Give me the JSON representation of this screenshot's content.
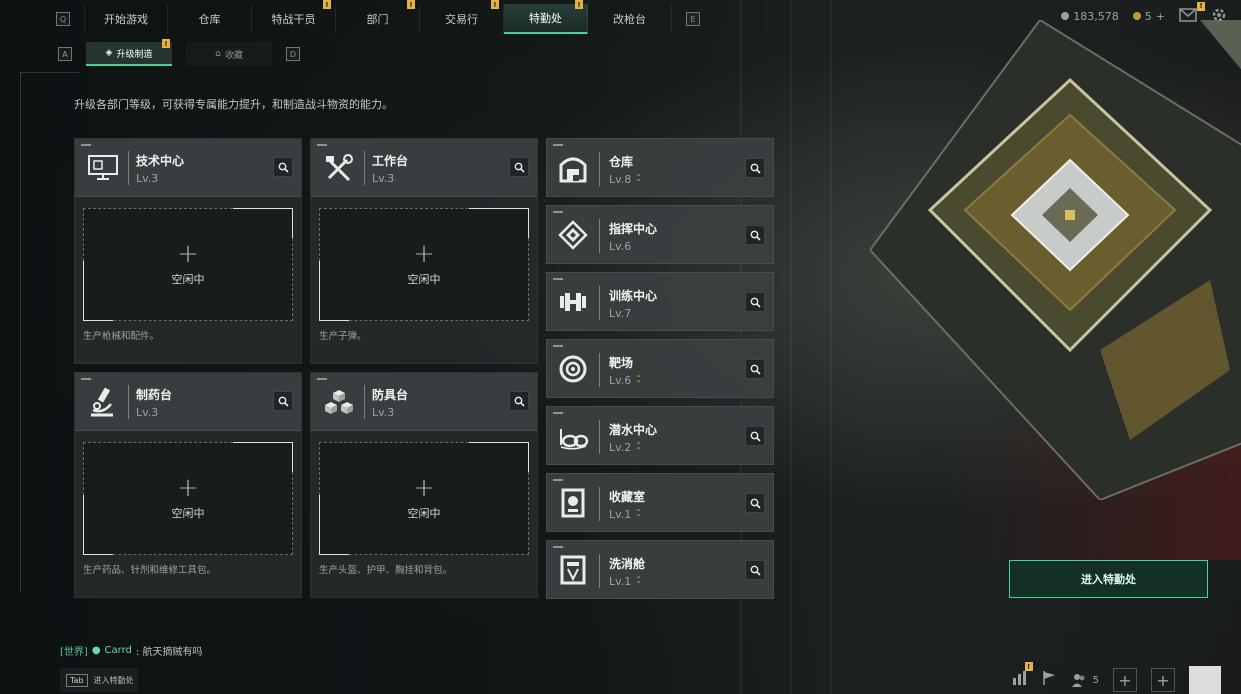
{
  "top_nav": {
    "left_key": "Q",
    "right_key": "E",
    "tabs": [
      {
        "label": "开始游戏",
        "active": false,
        "badge": false
      },
      {
        "label": "仓库",
        "active": false,
        "badge": false
      },
      {
        "label": "特战干员",
        "active": false,
        "badge": true
      },
      {
        "label": "部门",
        "active": false,
        "badge": true
      },
      {
        "label": "交易行",
        "active": false,
        "badge": true
      },
      {
        "label": "特勤处",
        "active": true,
        "badge": true
      },
      {
        "label": "改枪台",
        "active": false,
        "badge": false
      }
    ],
    "badge_text": "!"
  },
  "currency": {
    "primary_value": "183,578",
    "secondary_value": "5",
    "secondary_plus": "+"
  },
  "sub_nav": {
    "left_key": "A",
    "right_key": "D",
    "tabs": [
      {
        "label": "升级制造",
        "active": true
      },
      {
        "label": "收藏",
        "active": false
      }
    ]
  },
  "description": "升级各部门等级，可获得专属能力提升，和制造战斗物资的能力。",
  "production_cards": [
    {
      "name": "技术中心",
      "level": "Lv.3",
      "slot_status": "空闲中",
      "plus": "+",
      "desc": "生产枪械和配件。",
      "icon": "computer-icon"
    },
    {
      "name": "工作台",
      "level": "Lv.3",
      "slot_status": "空闲中",
      "plus": "+",
      "desc": "生产子弹。",
      "icon": "tools-icon"
    },
    {
      "name": "制药台",
      "level": "Lv.3",
      "slot_status": "空闲中",
      "plus": "+",
      "desc": "生产药品、针剂和维修工具包。",
      "icon": "microscope-icon"
    },
    {
      "name": "防具台",
      "level": "Lv.3",
      "slot_status": "空闲中",
      "plus": "+",
      "desc": "生产头盔、护甲、胸挂和背包。",
      "icon": "armor-icon"
    }
  ],
  "departments": [
    {
      "name": "仓库",
      "level": "Lv.8",
      "upgradable": true,
      "icon": "warehouse-icon"
    },
    {
      "name": "指挥中心",
      "level": "Lv.6",
      "upgradable": false,
      "icon": "command-chip-icon"
    },
    {
      "name": "训练中心",
      "level": "Lv.7",
      "upgradable": false,
      "icon": "dumbbell-icon"
    },
    {
      "name": "靶场",
      "level": "Lv.6",
      "upgradable": true,
      "icon": "target-icon"
    },
    {
      "name": "潜水中心",
      "level": "Lv.2",
      "upgradable": true,
      "icon": "diving-mask-icon"
    },
    {
      "name": "收藏室",
      "level": "Lv.1",
      "upgradable": true,
      "icon": "collection-icon"
    },
    {
      "name": "洗消舱",
      "level": "Lv.1",
      "upgradable": true,
      "icon": "decontamination-icon"
    }
  ],
  "enter_button": "进入特勤处",
  "chat": {
    "channel": "[世界]",
    "user": "Carrd",
    "message": ": 航天摘贼有吗"
  },
  "tab_hint": {
    "key": "Tab",
    "label": "进入特勤处"
  },
  "bottom": {
    "squad_count": "5",
    "plus_1": "+",
    "plus_2": "+"
  },
  "colors": {
    "accent": "#3fd49a",
    "badge": "#e3b445",
    "upgrade": "#d7a740"
  }
}
